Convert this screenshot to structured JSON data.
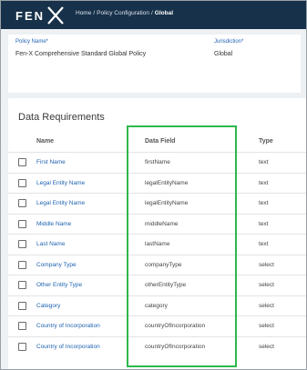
{
  "header": {
    "logo_text": "FEN",
    "breadcrumb": {
      "home": "Home",
      "sep1": "/",
      "section": "Policy Configuration",
      "sep2": "/",
      "current": "Global"
    }
  },
  "policy": {
    "name_label": "Policy Name*",
    "name_value": "Fen-X Comprehensive Standard Global Policy",
    "jurisdiction_label": "Jurisdiction*",
    "jurisdiction_value": "Global"
  },
  "requirements": {
    "title": "Data Requirements",
    "columns": {
      "name": "Name",
      "field": "Data Field",
      "type": "Type"
    },
    "rows": [
      {
        "name": "First Name",
        "field": "firstName",
        "type": "text"
      },
      {
        "name": "Legal Entity Name",
        "field": "legalEntityName",
        "type": "text"
      },
      {
        "name": "Legal Entity Name",
        "field": "legalEntityName",
        "type": "text"
      },
      {
        "name": "Middle Name",
        "field": "middleName",
        "type": "text"
      },
      {
        "name": "Last Name",
        "field": "lastName",
        "type": "text"
      },
      {
        "name": "Company Type",
        "field": "companyType",
        "type": "select"
      },
      {
        "name": "Other Entity Type",
        "field": "otherEntityType",
        "type": "select"
      },
      {
        "name": "Category",
        "field": "category",
        "type": "select"
      },
      {
        "name": "Country of Incorporation",
        "field": "countryOfIncorporation",
        "type": "select"
      },
      {
        "name": "Country of Incorporation",
        "field": "countryOfIncorporation",
        "type": "select"
      }
    ]
  },
  "colors": {
    "header_bg": "#17314a",
    "link": "#1f63b0",
    "highlight": "#2db84a"
  }
}
